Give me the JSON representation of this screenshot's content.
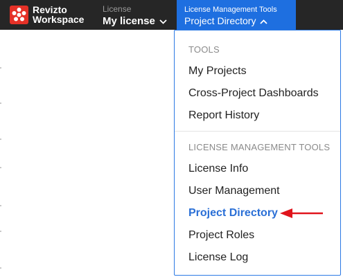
{
  "header": {
    "brand_line1": "Revizto",
    "brand_line2": "Workspace",
    "license_caption": "License",
    "license_value": "My license",
    "tools_caption": "License Management Tools",
    "tools_value": "Project Directory"
  },
  "menu": {
    "tools_section": "TOOLS",
    "tools_items": [
      "My Projects",
      "Cross-Project Dashboards",
      "Report History"
    ],
    "license_section": "LICENSE MANAGEMENT TOOLS",
    "license_items": [
      "License Info",
      "User Management",
      "Project Directory",
      "Project Roles",
      "License Log"
    ],
    "active_item": "Project Directory"
  },
  "colors": {
    "topbar": "#262626",
    "accent": "#1e6fe0",
    "active_text": "#2a6fd6",
    "brand_red": "#e53127",
    "annotation_arrow": "#e0141c"
  },
  "icons": {
    "logo": "revizto-logo-icon",
    "license_dropdown": "chevron-down-icon",
    "tools_dropdown": "chevron-up-icon",
    "annotation": "red-arrow-icon"
  }
}
